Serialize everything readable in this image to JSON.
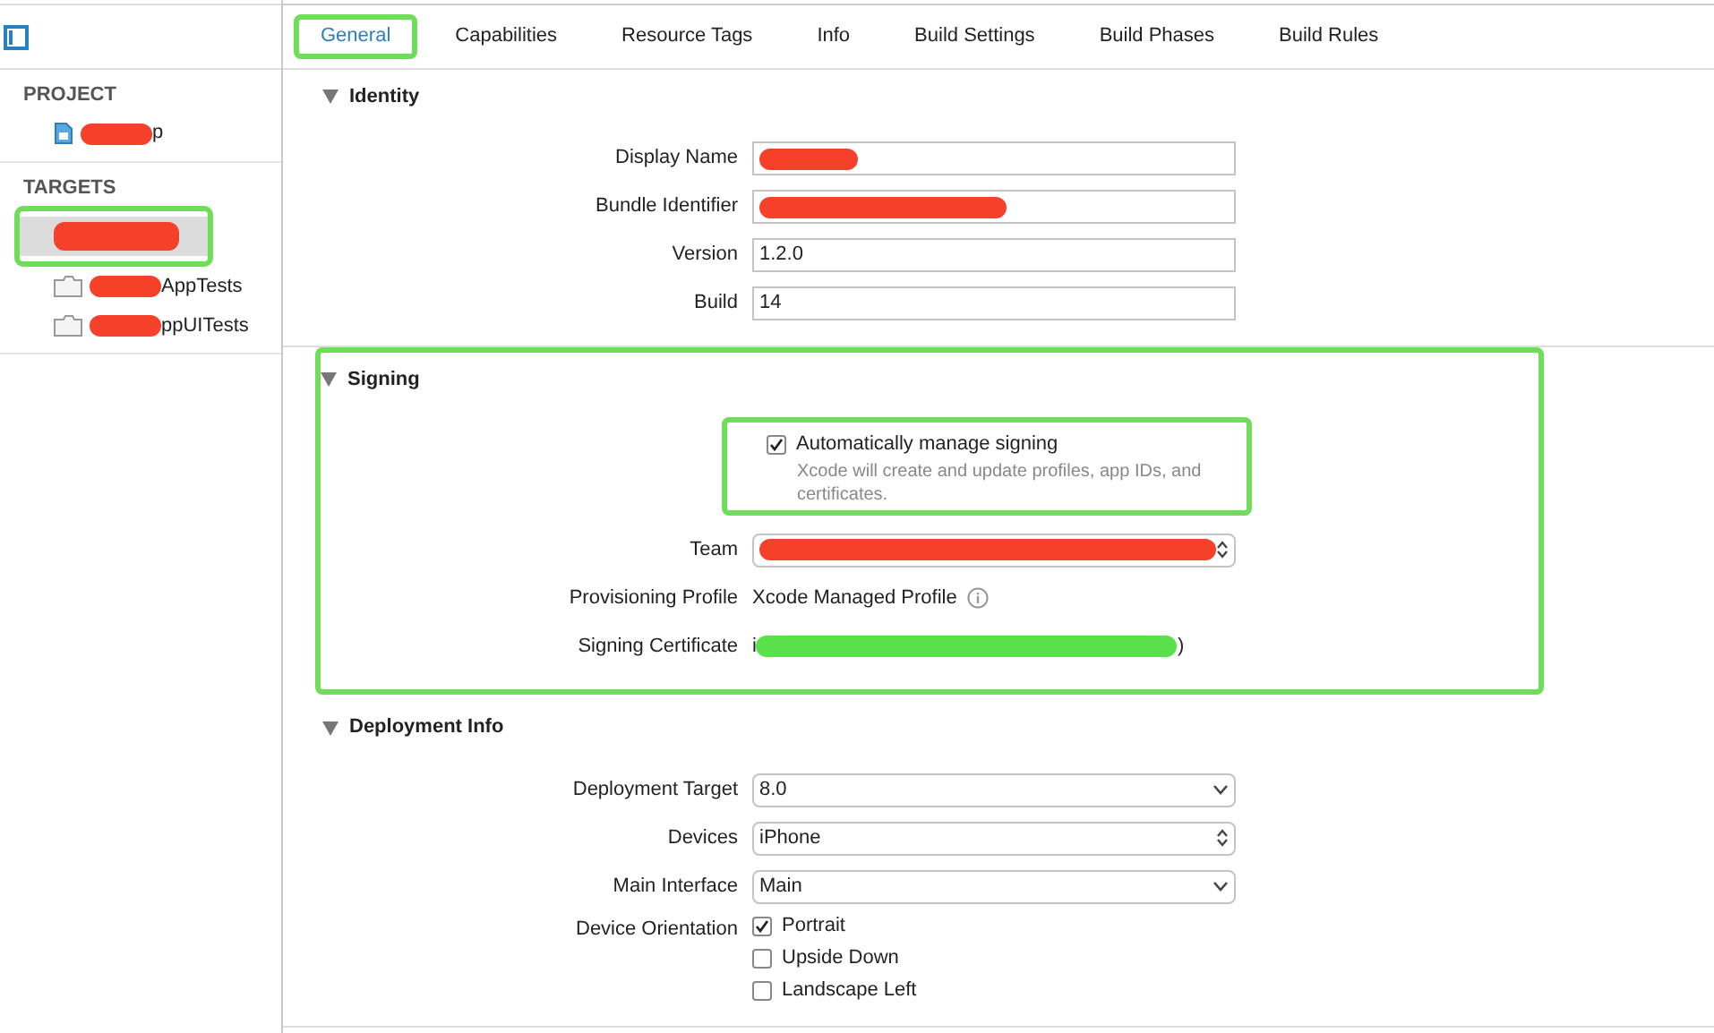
{
  "tabs": [
    {
      "label": "General",
      "selected": true,
      "highlighted": true
    },
    {
      "label": "Capabilities",
      "selected": false,
      "highlighted": false
    },
    {
      "label": "Resource Tags",
      "selected": false,
      "highlighted": false
    },
    {
      "label": "Info",
      "selected": false,
      "highlighted": false
    },
    {
      "label": "Build Settings",
      "selected": false,
      "highlighted": false
    },
    {
      "label": "Build Phases",
      "selected": false,
      "highlighted": false
    },
    {
      "label": "Build Rules",
      "selected": false,
      "highlighted": false
    }
  ],
  "sidebar": {
    "groups": [
      {
        "title": "PROJECT",
        "items": [
          {
            "kind": "project",
            "text": "p",
            "redacted": true,
            "selected": false
          }
        ]
      },
      {
        "title": "TARGETS",
        "items": [
          {
            "kind": "app",
            "redacted": true,
            "selected": true,
            "highlighted": true
          },
          {
            "kind": "folder",
            "text": "AppTests",
            "redacted": true,
            "selected": false,
            "highlighted": false
          },
          {
            "kind": "folder",
            "text": "ppUITests",
            "redacted": true,
            "selected": false,
            "highlighted": false
          }
        ]
      }
    ]
  },
  "sections": [
    {
      "title": "Identity",
      "expanded": true,
      "highlighted": false,
      "rows": [
        {
          "label": "Display Name",
          "kind": "text",
          "redacted": true,
          "color": "#f5402a"
        },
        {
          "label": "Bundle Identifier",
          "kind": "text",
          "redacted": true,
          "color": "#f5402a"
        },
        {
          "label": "Version",
          "kind": "text",
          "value": "1.2.0",
          "redacted": false
        },
        {
          "label": "Build",
          "kind": "text",
          "value": "14",
          "redacted": false
        }
      ]
    },
    {
      "title": "Signing",
      "expanded": true,
      "highlighted": true,
      "rows": [
        {
          "kind": "checkbox",
          "text": "Automatically manage signing",
          "checked": true,
          "note": "Xcode will create and update profiles, app IDs, and certificates.",
          "highlighted": true
        },
        {
          "label": "Team",
          "kind": "stepper",
          "redacted": true,
          "color": "#f5402a"
        },
        {
          "label": "Provisioning Profile",
          "kind": "info",
          "value": "Xcode Managed Profile"
        },
        {
          "label": "Signing Certificate",
          "kind": "label",
          "prefix": "i",
          "value": ")",
          "redacted": true,
          "color": "#5ae04a"
        }
      ]
    },
    {
      "title": "Deployment Info",
      "expanded": true,
      "highlighted": false,
      "rows": [
        {
          "label": "Deployment Target",
          "kind": "combo",
          "value": "8.0"
        },
        {
          "label": "Devices",
          "kind": "stepper",
          "value": "iPhone"
        },
        {
          "label": "Main Interface",
          "kind": "combo",
          "value": "Main"
        },
        {
          "label": "Device Orientation",
          "kind": "checks",
          "options": [
            {
              "text": "Portrait",
              "checked": true
            },
            {
              "text": "Upside Down",
              "checked": false
            },
            {
              "text": "Landscape Left",
              "checked": false
            }
          ]
        }
      ]
    }
  ]
}
